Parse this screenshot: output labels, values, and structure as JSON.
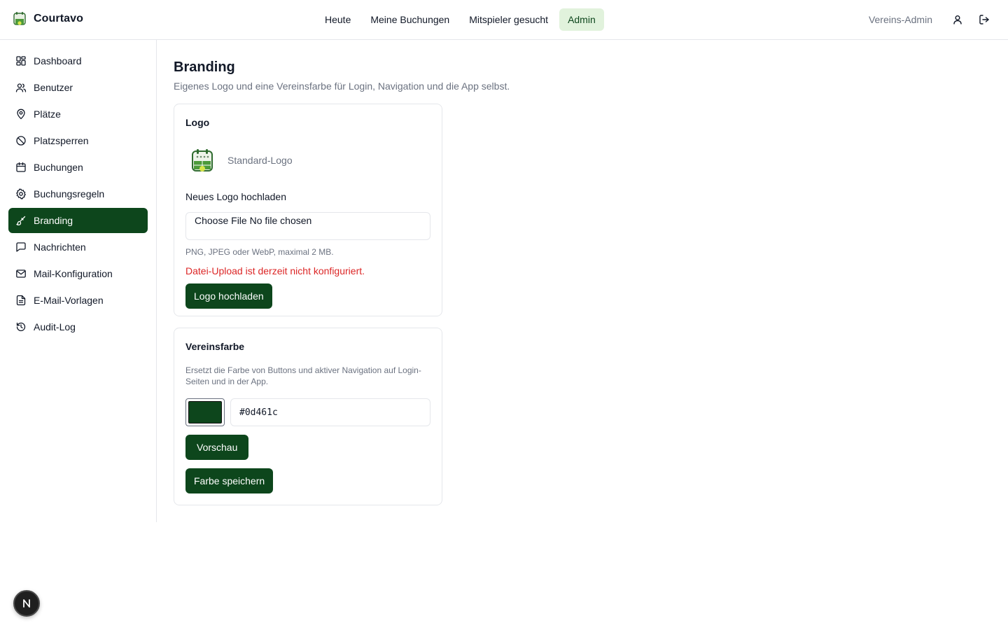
{
  "app": {
    "name": "Courtavo",
    "logo_icon": "tennis-court-logo-icon"
  },
  "topnav": {
    "items": [
      {
        "label": "Heute",
        "active": false
      },
      {
        "label": "Meine Buchungen",
        "active": false
      },
      {
        "label": "Mitspieler gesucht",
        "active": false
      },
      {
        "label": "Admin",
        "active": true
      }
    ]
  },
  "user": {
    "role": "Vereins-Admin",
    "profile_icon": "user-icon",
    "logout_icon": "logout-icon"
  },
  "sidebar": {
    "items": [
      {
        "label": "Dashboard",
        "icon": "dashboard-icon",
        "active": false
      },
      {
        "label": "Benutzer",
        "icon": "users-icon",
        "active": false
      },
      {
        "label": "Plätze",
        "icon": "map-pin-icon",
        "active": false
      },
      {
        "label": "Platzsperren",
        "icon": "ban-icon",
        "active": false
      },
      {
        "label": "Buchungen",
        "icon": "calendar-icon",
        "active": false
      },
      {
        "label": "Buchungsregeln",
        "icon": "gear-icon",
        "active": false
      },
      {
        "label": "Branding",
        "icon": "paintbrush-icon",
        "active": true
      },
      {
        "label": "Nachrichten",
        "icon": "message-icon",
        "active": false
      },
      {
        "label": "Mail-Konfiguration",
        "icon": "mail-icon",
        "active": false
      },
      {
        "label": "E-Mail-Vorlagen",
        "icon": "file-text-icon",
        "active": false
      },
      {
        "label": "Audit-Log",
        "icon": "history-icon",
        "active": false
      }
    ]
  },
  "page": {
    "title": "Branding",
    "subtitle": "Eigenes Logo und eine Vereinsfarbe für Login, Navigation und die App selbst."
  },
  "logo_card": {
    "title": "Logo",
    "caption": "Standard-Logo",
    "upload_label": "Neues Logo hochladen",
    "file_input_text": "Choose File No file chosen",
    "help": "PNG, JPEG oder WebP, maximal 2 MB.",
    "error": "Datei-Upload ist derzeit nicht konfiguriert.",
    "upload_button": "Logo hochladen"
  },
  "color_card": {
    "title": "Vereinsfarbe",
    "description": "Ersetzt die Farbe von Buttons und aktiver Navigation auf Login-Seiten und in der App.",
    "hex_value": "#0d461c",
    "preview_button": "Vorschau",
    "save_button": "Farbe speichern"
  },
  "colors": {
    "accent": "#0d461c",
    "accent_soft": "#e1f2dc",
    "error": "#dc2626"
  },
  "fab": {
    "icon": "next-n-icon"
  }
}
